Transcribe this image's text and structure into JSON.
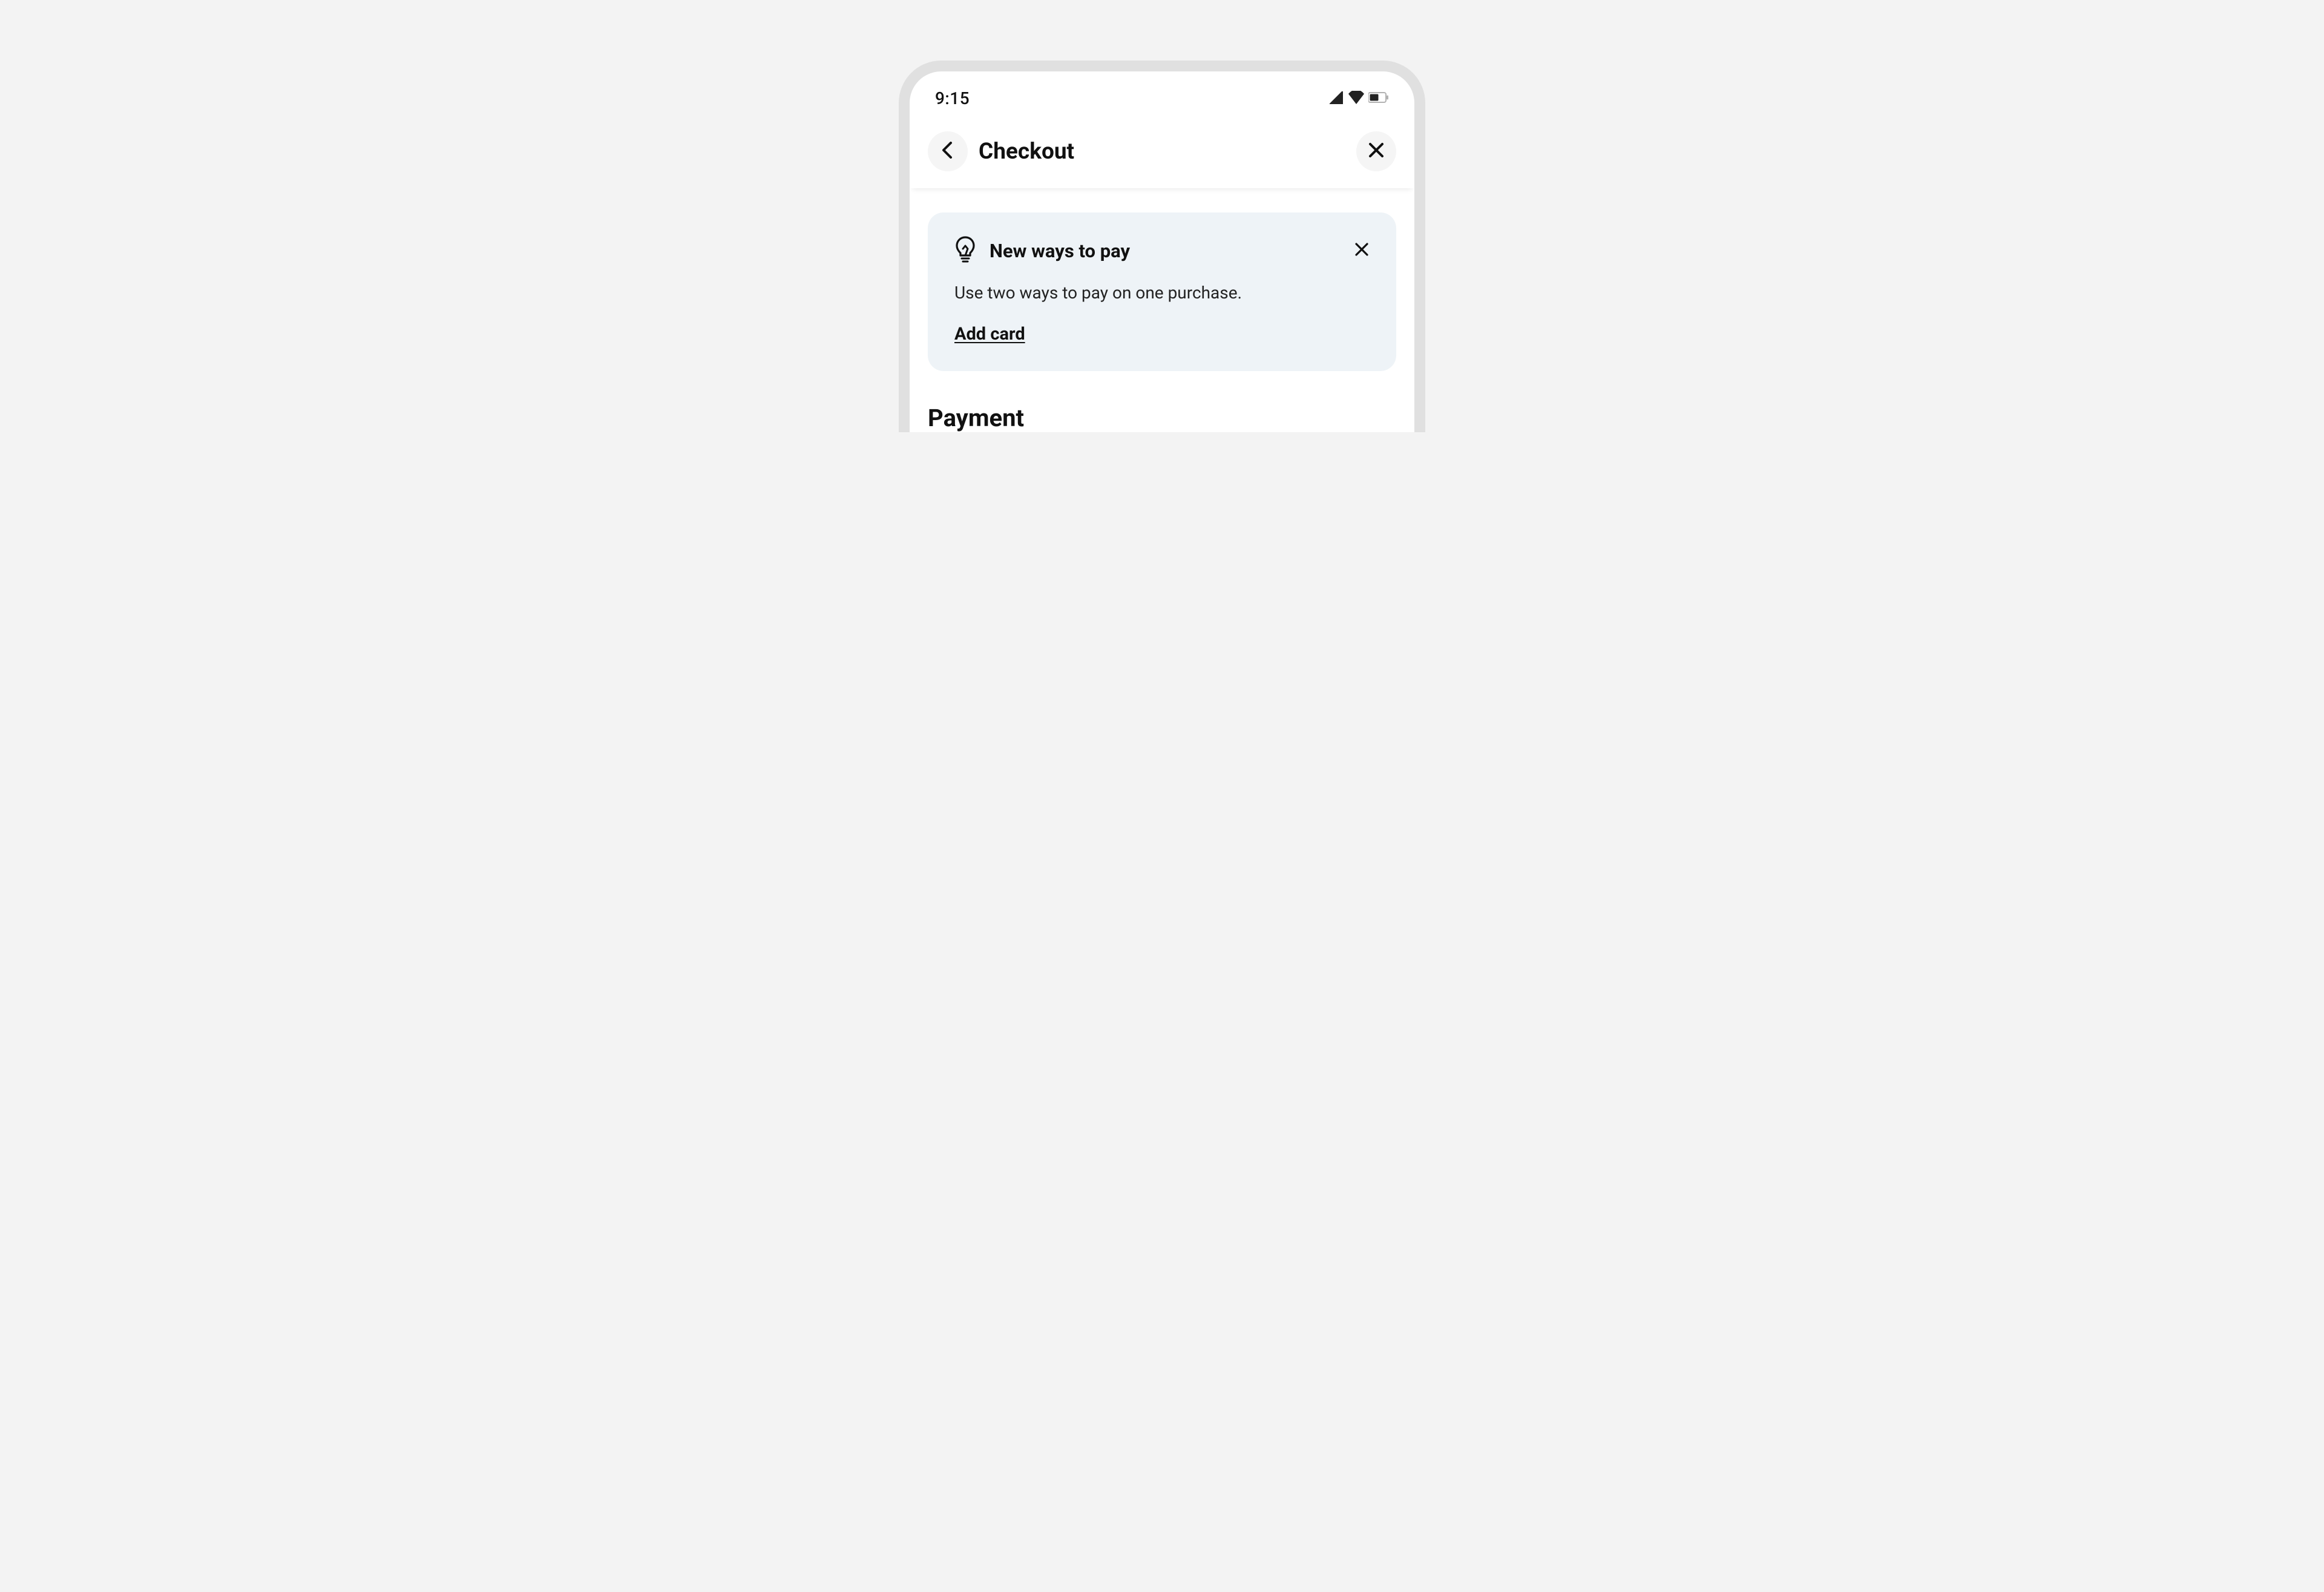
{
  "status_bar": {
    "time": "9:15"
  },
  "app_bar": {
    "title": "Checkout"
  },
  "info_card": {
    "title": "New ways to pay",
    "body": "Use two ways to pay on one purchase.",
    "action": "Add card"
  },
  "sections": {
    "payment_title": "Payment"
  }
}
